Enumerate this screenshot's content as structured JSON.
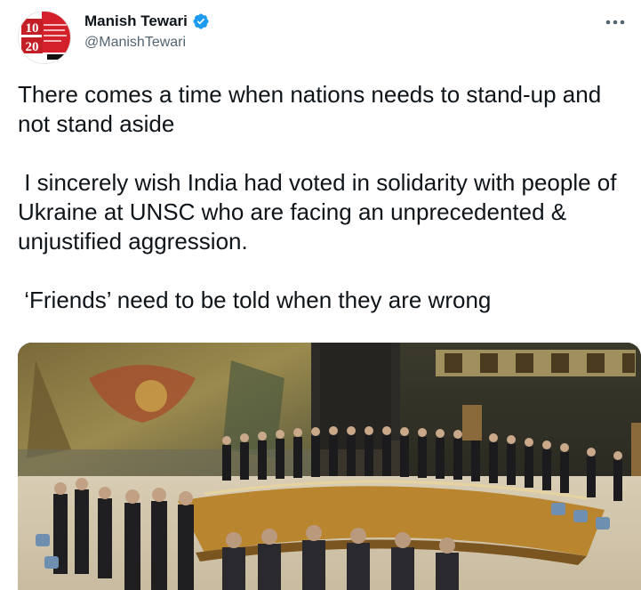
{
  "author": {
    "display_name": "Manish Tewari",
    "handle": "@ManishTewari",
    "verified": true,
    "avatar_text_top": "10",
    "avatar_text_bottom": "20"
  },
  "tweet": {
    "paragraphs": [
      "There comes a time when nations needs to stand-up and not stand aside",
      " I sincerely wish India had voted in solidarity with people of Ukraine at UNSC who are facing an unprecedented & unjustified aggression.",
      " ‘Friends’ need to be told when they are wrong"
    ]
  },
  "icons": {
    "verified": "verified-badge-icon",
    "more": "more-options-icon"
  },
  "colors": {
    "verified_blue": "#1d9bf0",
    "handle_gray": "#536471",
    "avatar_red": "#d4202a"
  }
}
